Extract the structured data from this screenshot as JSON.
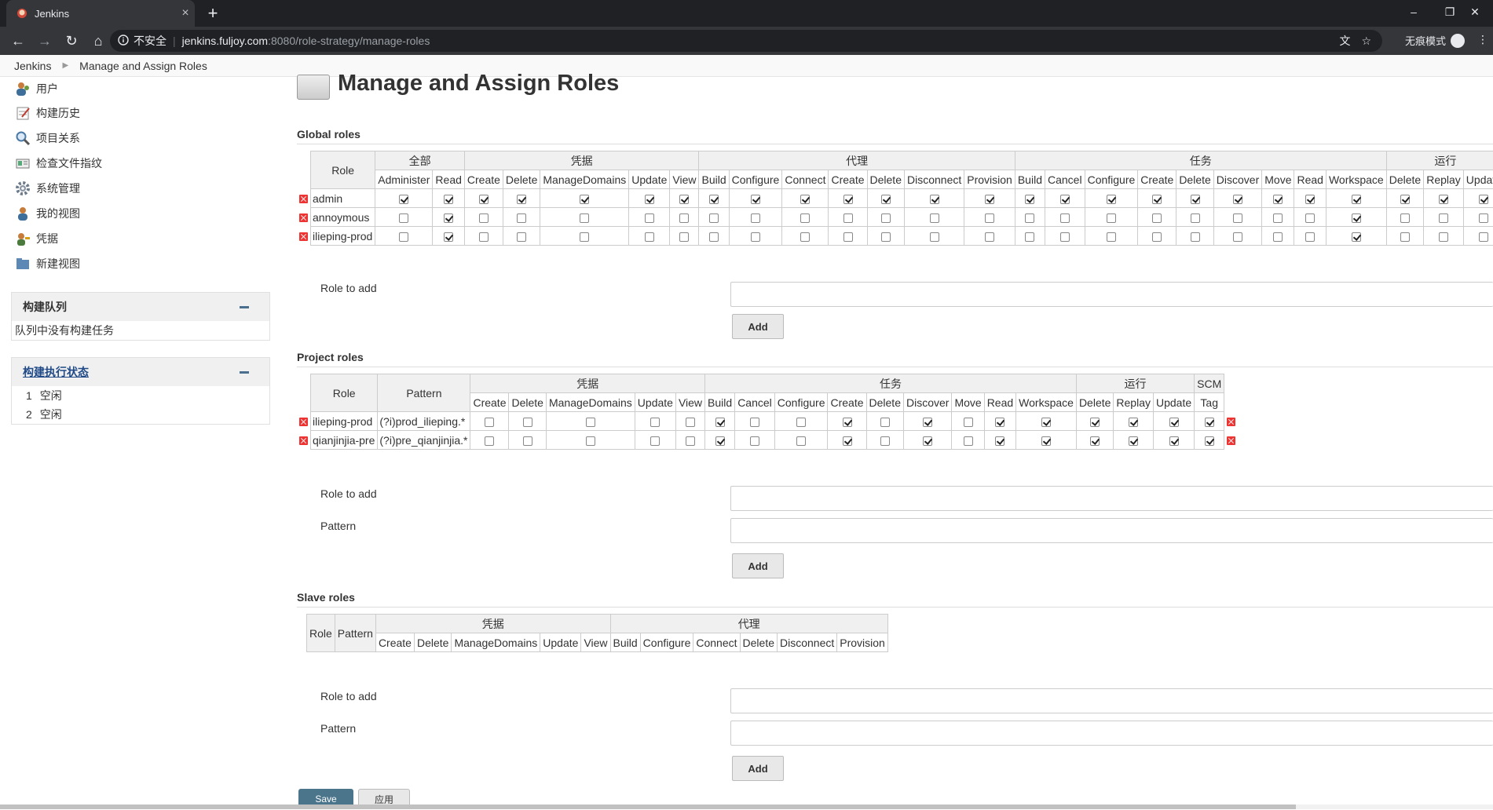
{
  "browser": {
    "tab_title": "Jenkins",
    "tab_close": "×",
    "new_tab": "+",
    "url_info": "不安全",
    "url_host": "jenkins.fuljoy.com",
    "url_path": ":8080/role-strategy/manage-roles",
    "incognito_label": "无痕模式"
  },
  "breadcrumbs": {
    "home": "Jenkins",
    "current": "Manage and Assign Roles"
  },
  "sidebar": {
    "tasks": [
      {
        "label": "用户",
        "icon": "people-icon"
      },
      {
        "label": "构建历史",
        "icon": "notepad-icon"
      },
      {
        "label": "项目关系",
        "icon": "magnifier-icon"
      },
      {
        "label": "检查文件指纹",
        "icon": "fingerprint-icon"
      },
      {
        "label": "系统管理",
        "icon": "gear-icon"
      },
      {
        "label": "我的视图",
        "icon": "user-icon"
      },
      {
        "label": "凭据",
        "icon": "key-icon"
      },
      {
        "label": "新建视图",
        "icon": "folder-icon"
      }
    ],
    "build_queue": {
      "title": "构建队列",
      "empty": "队列中没有构建任务"
    },
    "executors": {
      "title": "构建执行状态",
      "rows": [
        {
          "num": "1",
          "state": "空闲"
        },
        {
          "num": "2",
          "state": "空闲"
        }
      ]
    }
  },
  "page": {
    "title": "Manage and Assign Roles",
    "global_title": "Global roles",
    "project_title": "Project roles",
    "slave_title": "Slave roles",
    "role_to_add": "Role to add",
    "pattern": "Pattern",
    "add": "Add",
    "save": "Save",
    "apply": "应用"
  },
  "global": {
    "role_header": "Role",
    "groups": [
      {
        "name": "全部",
        "perms": [
          "Administer",
          "Read"
        ]
      },
      {
        "name": "凭据",
        "perms": [
          "Create",
          "Delete",
          "ManageDomains",
          "Update",
          "View"
        ]
      },
      {
        "name": "代理",
        "perms": [
          "Build",
          "Configure",
          "Connect",
          "Create",
          "Delete",
          "Disconnect",
          "Provision"
        ]
      },
      {
        "name": "任务",
        "perms": [
          "Build",
          "Cancel",
          "Configure",
          "Create",
          "Delete",
          "Discover",
          "Move",
          "Read",
          "Workspace"
        ]
      },
      {
        "name": "运行",
        "perms": [
          "Delete",
          "Replay",
          "Update"
        ]
      }
    ],
    "rows": [
      {
        "name": "admin",
        "checks": [
          1,
          1,
          1,
          1,
          1,
          1,
          1,
          1,
          1,
          1,
          1,
          1,
          1,
          1,
          1,
          1,
          1,
          1,
          1,
          1,
          1,
          1,
          1,
          1,
          1,
          1
        ]
      },
      {
        "name": "annoymous",
        "checks": [
          0,
          1,
          0,
          0,
          0,
          0,
          0,
          0,
          0,
          0,
          0,
          0,
          0,
          0,
          0,
          0,
          0,
          0,
          0,
          0,
          0,
          0,
          1,
          0,
          0,
          0
        ]
      },
      {
        "name": "ilieping-prod",
        "checks": [
          0,
          1,
          0,
          0,
          0,
          0,
          0,
          0,
          0,
          0,
          0,
          0,
          0,
          0,
          0,
          0,
          0,
          0,
          0,
          0,
          0,
          0,
          1,
          0,
          0,
          0
        ]
      }
    ]
  },
  "project": {
    "role_header": "Role",
    "pattern_header": "Pattern",
    "groups": [
      {
        "name": "凭据",
        "perms": [
          "Create",
          "Delete",
          "ManageDomains",
          "Update",
          "View"
        ]
      },
      {
        "name": "任务",
        "perms": [
          "Build",
          "Cancel",
          "Configure",
          "Create",
          "Delete",
          "Discover",
          "Move",
          "Read",
          "Workspace"
        ]
      },
      {
        "name": "运行",
        "perms": [
          "Delete",
          "Replay",
          "Update"
        ]
      },
      {
        "name": "SCM",
        "perms": [
          "Tag"
        ]
      }
    ],
    "rows": [
      {
        "name": "ilieping-prod",
        "pattern": "(?i)prod_ilieping.*",
        "checks": [
          0,
          0,
          0,
          0,
          0,
          1,
          0,
          0,
          1,
          0,
          1,
          0,
          1,
          1,
          1,
          1,
          1,
          1
        ]
      },
      {
        "name": "qianjinjia-pre",
        "pattern": "(?i)pre_qianjinjia.*",
        "checks": [
          0,
          0,
          0,
          0,
          0,
          1,
          0,
          0,
          1,
          0,
          1,
          0,
          1,
          1,
          1,
          1,
          1,
          1
        ]
      }
    ]
  },
  "slave": {
    "role_header": "Role",
    "pattern_header": "Pattern",
    "groups": [
      {
        "name": "凭据",
        "perms": [
          "Create",
          "Delete",
          "ManageDomains",
          "Update",
          "View"
        ]
      },
      {
        "name": "代理",
        "perms": [
          "Build",
          "Configure",
          "Connect",
          "Delete",
          "Disconnect",
          "Provision"
        ]
      }
    ]
  }
}
